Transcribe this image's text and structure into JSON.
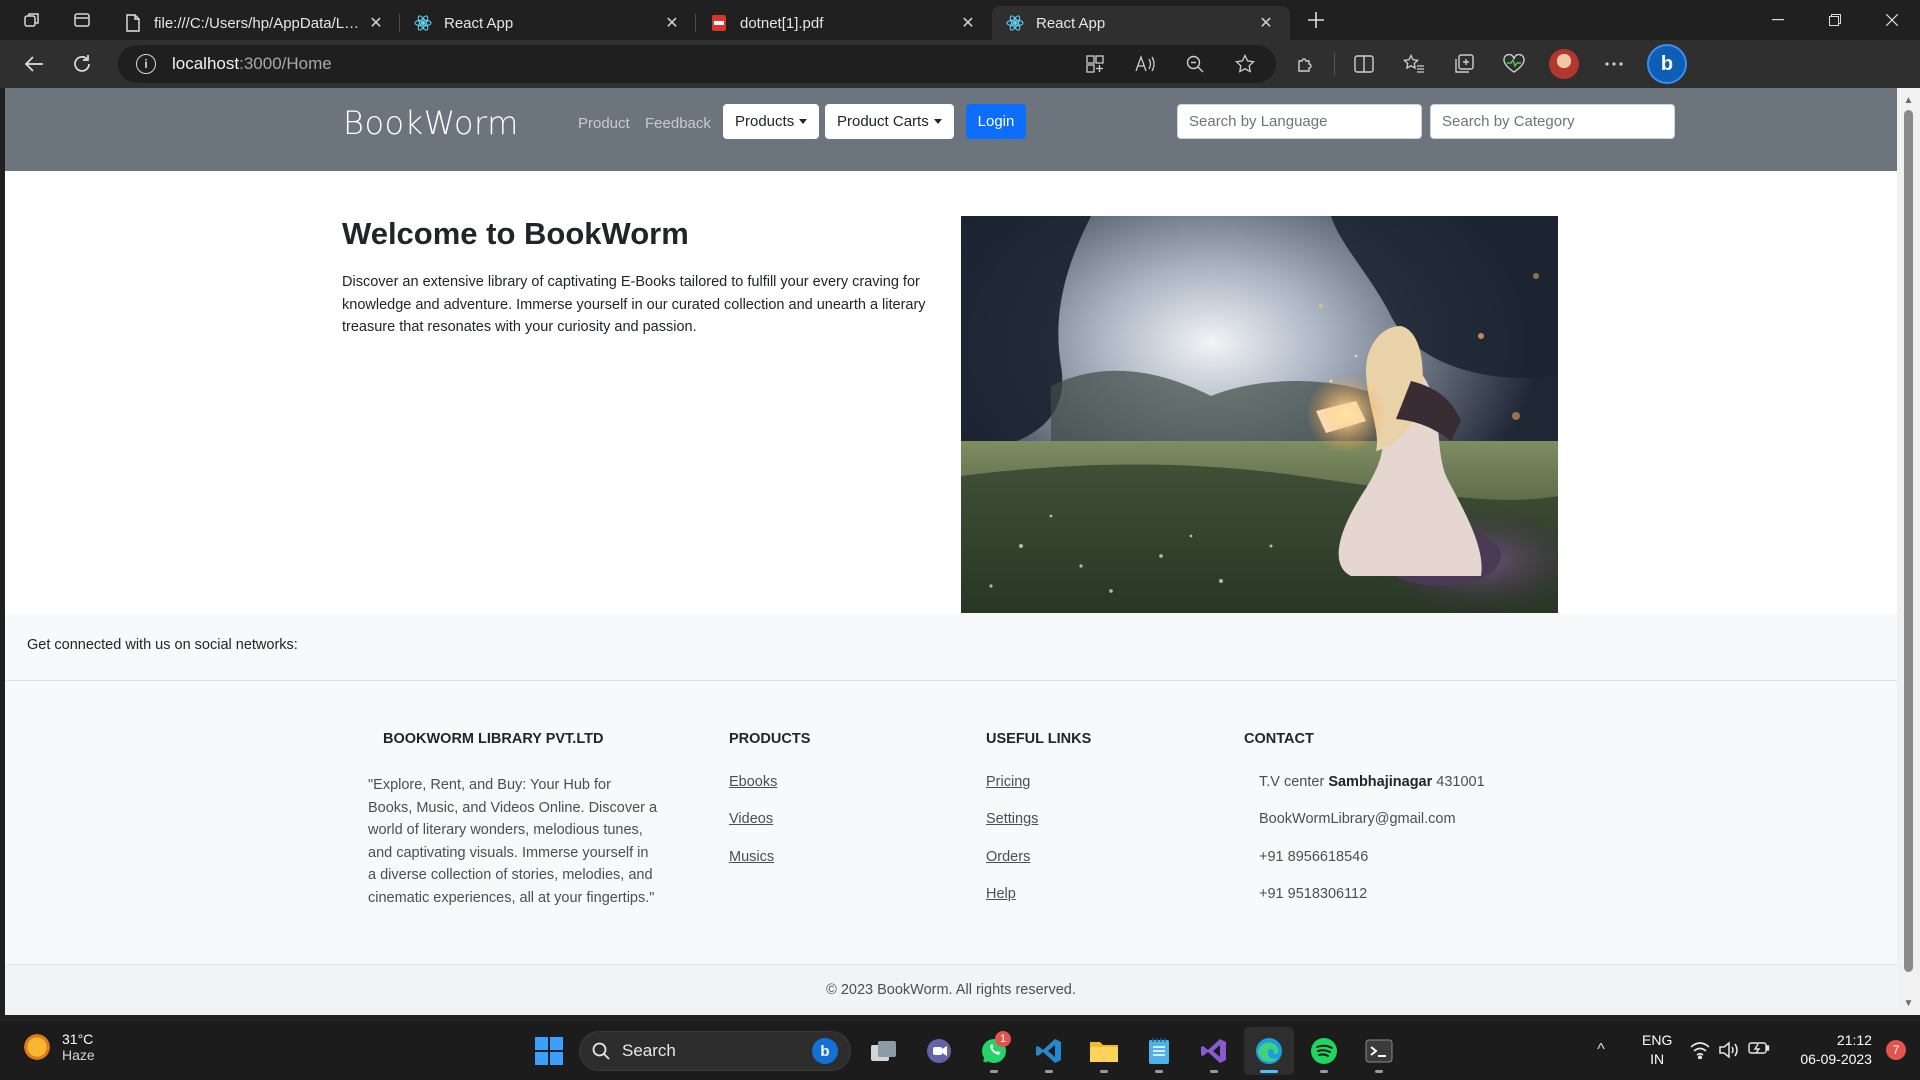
{
  "browser": {
    "tabs": [
      {
        "title": "file:///C:/Users/hp/AppData/Local/Temp",
        "favicon": "file-icon",
        "active": false
      },
      {
        "title": "React App",
        "favicon": "react-icon",
        "active": false
      },
      {
        "title": "dotnet[1].pdf",
        "favicon": "pdf-icon",
        "active": false
      },
      {
        "title": "React App",
        "favicon": "react-icon",
        "active": true
      }
    ],
    "close_glyph": "✕",
    "url_host": "localhost",
    "url_path": ":3000/Home"
  },
  "site": {
    "brand": "BookWorm",
    "nav_links": [
      "Product",
      "Feedback"
    ],
    "dropdowns": [
      "Products",
      "Product Carts"
    ],
    "login_label": "Login",
    "search_language_placeholder": "Search by Language",
    "search_category_placeholder": "Search by Category",
    "accent_color": "#0d6efd",
    "navbar_color": "#6c757d"
  },
  "hero": {
    "title": "Welcome to BookWorm",
    "text": "Discover an extensive library of captivating E-Books tailored to fulfill your every craving for knowledge and adventure. Immerse yourself in our curated collection and unearth a literary treasure that resonates with your curiosity and passion."
  },
  "social": {
    "text": "Get connected with us on social networks:"
  },
  "footer": {
    "company": {
      "heading": "BOOKWORM LIBRARY PVT.LTD",
      "about": "\"Explore, Rent, and Buy: Your Hub for Books, Music, and Videos Online. Discover a world of literary wonders, melodious tunes, and captivating visuals. Immerse yourself in a diverse collection of stories, melodies, and cinematic experiences, all at your fingertips.\""
    },
    "products": {
      "heading": "PRODUCTS",
      "links": [
        "Ebooks",
        "Videos",
        "Musics"
      ]
    },
    "useful_links": {
      "heading": "USEFUL LINKS",
      "links": [
        "Pricing",
        "Settings",
        "Orders",
        "Help"
      ]
    },
    "contact": {
      "heading": "CONTACT",
      "address_prefix": "T.V center ",
      "address_city": "Sambhajinagar",
      "address_pin": " 431001",
      "email": "BookWormLibrary@gmail.com",
      "phone1": "+91 8956618546",
      "phone2": "+91 9518306112"
    },
    "copyright": "© 2023 BookWorm. All rights reserved."
  },
  "taskbar": {
    "weather_temp": "31°C",
    "weather_desc": "Haze",
    "search_label": "Search",
    "whatsapp_badge": "1",
    "lang_top": "ENG",
    "lang_bottom": "IN",
    "time": "21:12",
    "date": "06-09-2023",
    "notification_count": "7"
  }
}
